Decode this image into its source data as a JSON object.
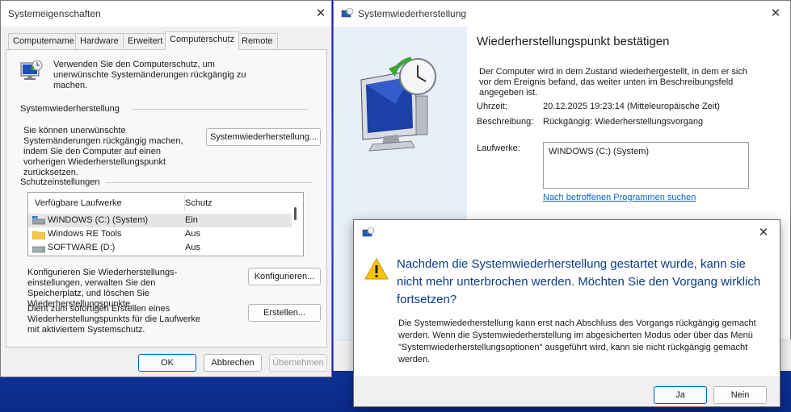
{
  "sysprops": {
    "title": "Systemeigenschaften",
    "tabs": [
      "Computername",
      "Hardware",
      "Erweitert",
      "Computerschutz",
      "Remote"
    ],
    "active_tab": "Computerschutz",
    "intro": "Verwenden Sie den Computerschutz, um unerwünschte Systemänderungen rückgängig zu machen.",
    "restore_section": "Systemwiederherstellung",
    "restore_desc": "Sie können unerwünschte Systemänderungen rückgängig machen, indem Sie den Computer auf einen vorherigen Wiederherstellungspunkt zurücksetzen.",
    "restore_button": "Systemwiederherstellung...",
    "protection_section": "Schutzeinstellungen",
    "list_headers": {
      "drives": "Verfügbare Laufwerke",
      "protection": "Schutz"
    },
    "drives": [
      {
        "name": "WINDOWS (C:) (System)",
        "status": "Ein",
        "icon": "system-drive-icon"
      },
      {
        "name": "Windows RE Tools",
        "status": "Aus",
        "icon": "folder-icon"
      },
      {
        "name": "SOFTWARE (D:)",
        "status": "Aus",
        "icon": "drive-icon"
      }
    ],
    "configure_desc": "Konfigurieren Sie Wiederherstellungs-einstellungen, verwalten Sie den Speicherplatz, und löschen Sie Wiederherstellungspunkte.",
    "configure_button": "Konfigurieren...",
    "create_desc": "Dient zum sofortigen Erstellen eines Wiederherstellungspunkts für die Laufwerke mit aktiviertem Systemschutz.",
    "create_button": "Erstellen...",
    "ok": "OK",
    "cancel": "Abbrechen",
    "apply": "Übernehmen"
  },
  "restore": {
    "title": "Systemwiederherstellung",
    "heading": "Wiederherstellungspunkt bestätigen",
    "desc": "Der Computer wird in dem Zustand wiederhergestellt, in dem er sich vor dem Ereignis befand, das weiter unten im Beschreibungsfeld angegeben ist.",
    "time_label": "Uhrzeit:",
    "time_value": "20.12.2025 19:23:14 (Mitteleuropäische Zeit)",
    "desc_label": "Beschreibung:",
    "desc_value": "Rückgängig: Wiederherstellungsvorgang",
    "drives_label": "Laufwerke:",
    "drives_value": "WINDOWS (C:) (System)",
    "link": "Nach betroffenen Programmen suchen"
  },
  "confirm": {
    "main": "Nachdem die Systemwiederherstellung gestartet wurde, kann sie nicht mehr unterbrochen werden. Möchten Sie den Vorgang wirklich fortsetzen?",
    "detail": "Die Systemwiederherstellung kann erst nach Abschluss des Vorgangs rückgängig gemacht werden. Wenn die Systemwiederherstellung im abgesicherten Modus oder über das Menü \"Systemwiederherstellungsoptionen\" ausgeführt wird, kann sie nicht rückgängig gemacht werden.",
    "yes": "Ja",
    "no": "Nein"
  },
  "colors": {
    "accent": "#005fb8",
    "heading_blue": "#0a3b8c",
    "link": "#0a64c8",
    "warning": "#ffc400"
  }
}
